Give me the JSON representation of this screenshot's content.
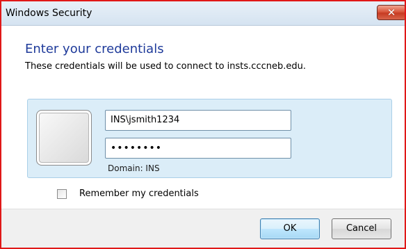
{
  "window": {
    "title": "Windows Security",
    "close_glyph": "✕"
  },
  "dialog": {
    "heading": "Enter your credentials",
    "subtext": "These credentials will be used to connect to insts.cccneb.edu."
  },
  "credentials": {
    "username": "INS\\jsmith1234",
    "password_mask": "••••••••",
    "domain_label": "Domain: INS",
    "avatar_icon": "user-tile-icon"
  },
  "remember": {
    "label": "Remember my credentials",
    "checked": false
  },
  "buttons": {
    "ok": "OK",
    "cancel": "Cancel"
  },
  "colors": {
    "frame_border": "#e01818",
    "heading_blue": "#1e3a9a",
    "tile_background": "#dbedf8"
  }
}
